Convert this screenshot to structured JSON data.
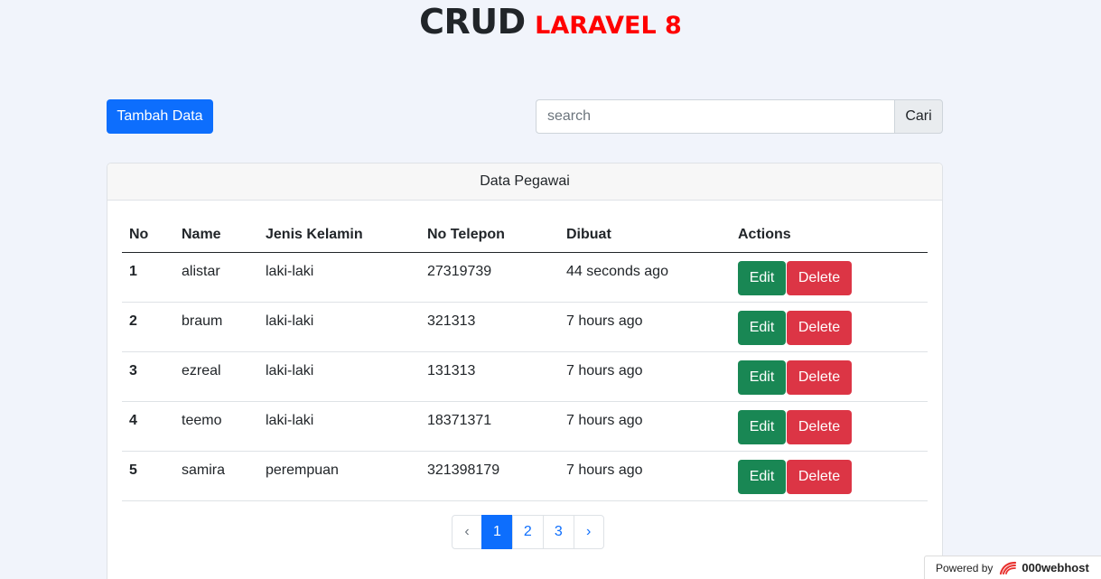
{
  "header": {
    "title_main": "CRUD",
    "title_sub": "LARAVEL 8"
  },
  "toolbar": {
    "add_label": "Tambah Data",
    "search_placeholder": "search",
    "search_value": "",
    "search_button": "Cari"
  },
  "card": {
    "title": "Data Pegawai"
  },
  "table": {
    "columns": [
      "No",
      "Name",
      "Jenis Kelamin",
      "No Telepon",
      "Dibuat",
      "Actions"
    ],
    "rows": [
      {
        "no": "1",
        "name": "alistar",
        "gender": "laki-laki",
        "phone": "27319739",
        "created": "44 seconds ago"
      },
      {
        "no": "2",
        "name": "braum",
        "gender": "laki-laki",
        "phone": "321313",
        "created": "7 hours ago"
      },
      {
        "no": "3",
        "name": "ezreal",
        "gender": "laki-laki",
        "phone": "131313",
        "created": "7 hours ago"
      },
      {
        "no": "4",
        "name": "teemo",
        "gender": "laki-laki",
        "phone": "18371371",
        "created": "7 hours ago"
      },
      {
        "no": "5",
        "name": "samira",
        "gender": "perempuan",
        "phone": "321398179",
        "created": "7 hours ago"
      }
    ],
    "edit_label": "Edit",
    "delete_label": "Delete"
  },
  "pagination": {
    "prev": "‹",
    "pages": [
      "1",
      "2",
      "3"
    ],
    "active": "1",
    "next": "›"
  },
  "footer": {
    "powered_by": "Powered by",
    "brand": "000webhost"
  },
  "colors": {
    "primary": "#0d6efd",
    "success": "#198754",
    "danger": "#dc3545",
    "title_accent": "#ff0000"
  }
}
